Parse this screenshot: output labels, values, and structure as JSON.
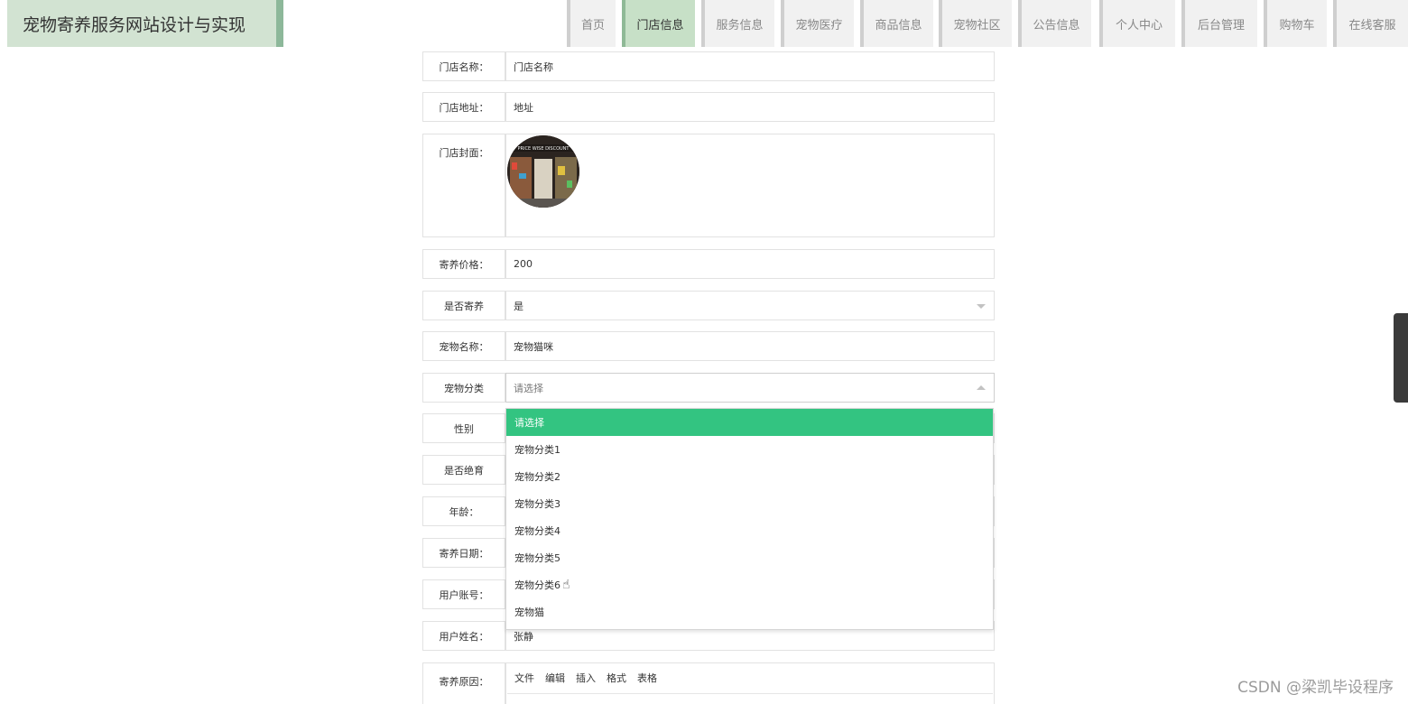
{
  "header": {
    "site_title": "宠物寄养服务网站设计与实现",
    "nav": [
      {
        "label": "首页",
        "active": false
      },
      {
        "label": "门店信息",
        "active": true
      },
      {
        "label": "服务信息",
        "active": false
      },
      {
        "label": "宠物医疗",
        "active": false
      },
      {
        "label": "商品信息",
        "active": false
      },
      {
        "label": "宠物社区",
        "active": false
      },
      {
        "label": "公告信息",
        "active": false
      },
      {
        "label": "个人中心",
        "active": false
      },
      {
        "label": "后台管理",
        "active": false
      },
      {
        "label": "购物车",
        "active": false
      },
      {
        "label": "在线客服",
        "active": false
      }
    ]
  },
  "form": {
    "store_name": {
      "label": "门店名称：",
      "value": "门店名称"
    },
    "store_address": {
      "label": "门店地址：",
      "value": "地址"
    },
    "store_cover": {
      "label": "门店封面：",
      "image_text": "PRICE WISE DISCOUNT"
    },
    "price": {
      "label": "寄养价格：",
      "value": "200"
    },
    "is_boarding": {
      "label": "是否寄养",
      "value": "是"
    },
    "pet_name": {
      "label": "宠物名称：",
      "value": "宠物猫咪"
    },
    "pet_category": {
      "label": "宠物分类",
      "placeholder": "请选择"
    },
    "gender": {
      "label": "性别"
    },
    "neutered": {
      "label": "是否绝育"
    },
    "age": {
      "label": "年龄："
    },
    "board_date": {
      "label": "寄养日期："
    },
    "user_account": {
      "label": "用户账号："
    },
    "user_name": {
      "label": "用户姓名：",
      "value": "张静"
    },
    "reason": {
      "label": "寄养原因："
    }
  },
  "dropdown": {
    "options": [
      "请选择",
      "宠物分类1",
      "宠物分类2",
      "宠物分类3",
      "宠物分类4",
      "宠物分类5",
      "宠物分类6",
      "宠物猫"
    ],
    "selected_index": 0,
    "selected_color": "#33c481"
  },
  "editor": {
    "menu": [
      "文件",
      "编辑",
      "插入",
      "格式",
      "表格"
    ]
  },
  "watermark": "CSDN @梁凯毕设程序"
}
